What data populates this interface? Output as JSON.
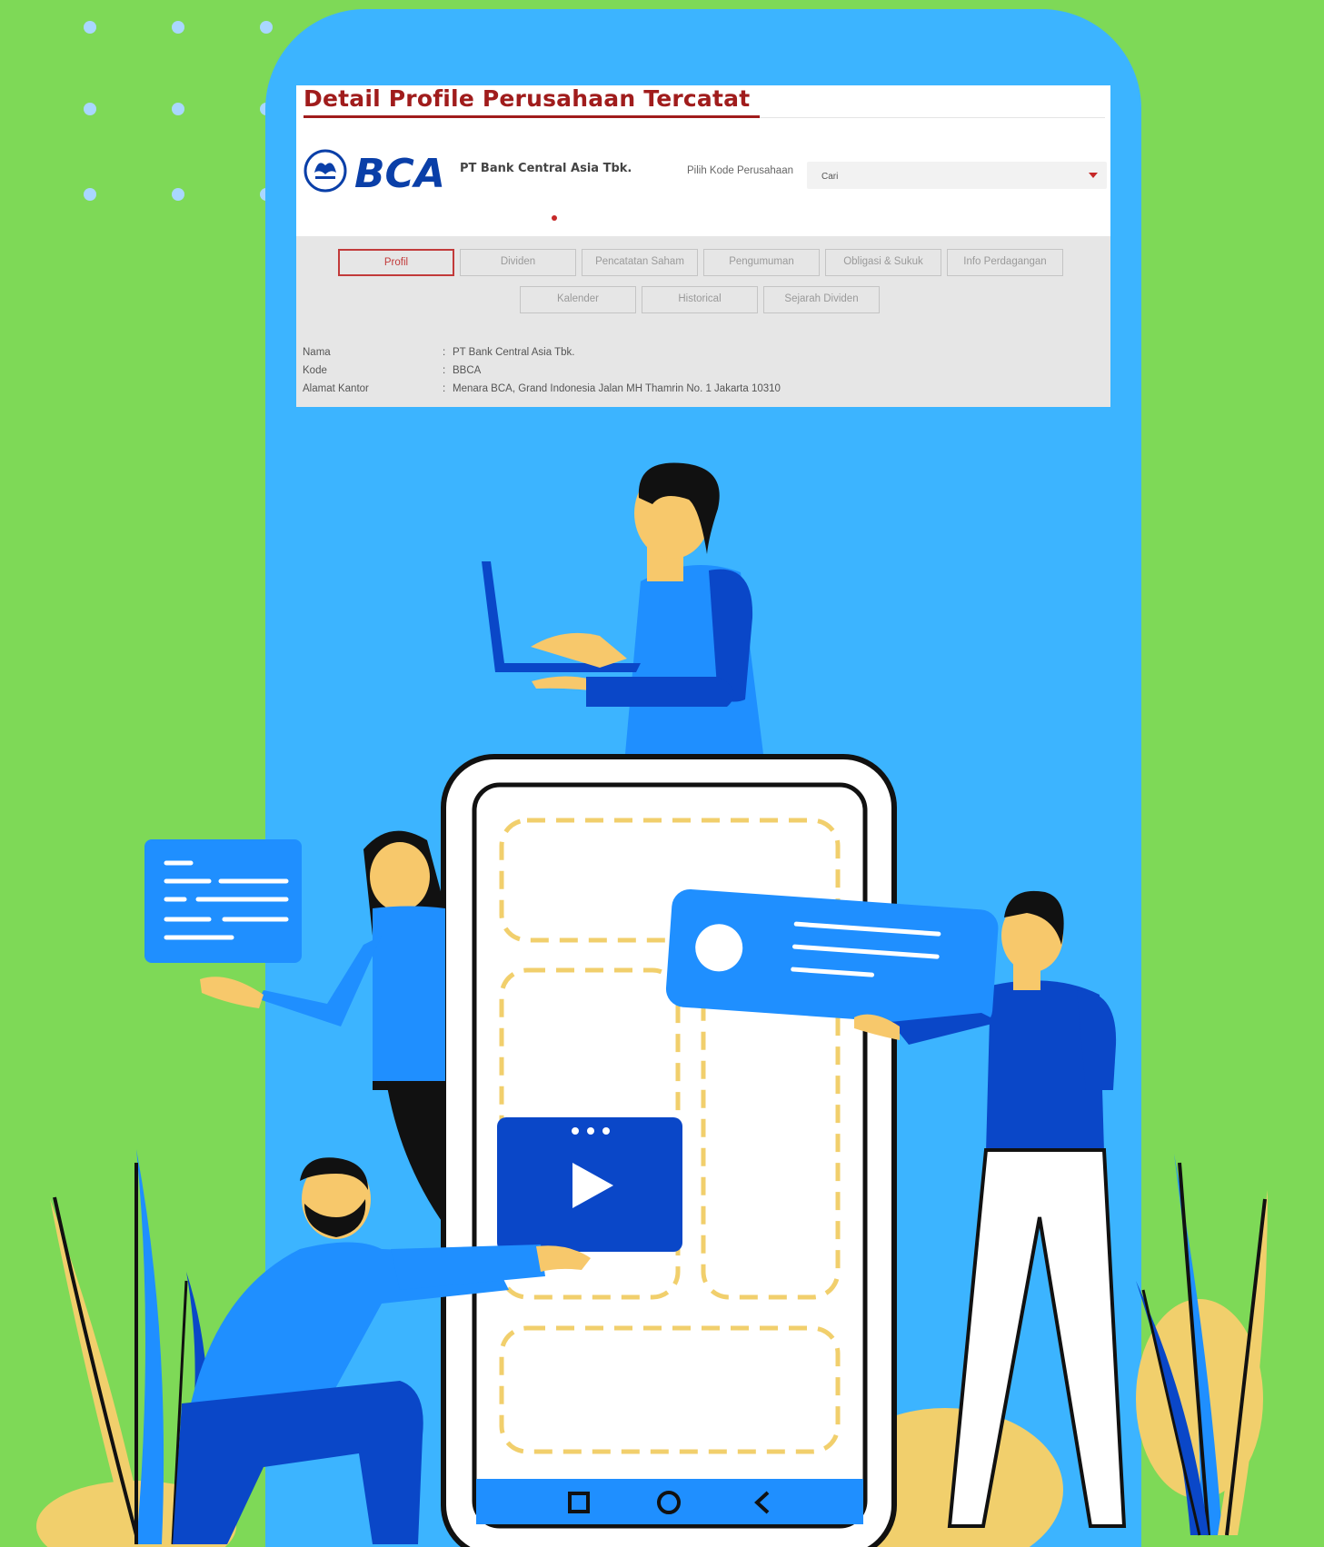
{
  "panel": {
    "title": "Detail Profile Perusahaan Tercatat",
    "company_name": "PT Bank Central Asia Tbk.",
    "logo_text": "BCA",
    "pick_label": "Pilih Kode Perusahaan",
    "select_value": "Cari"
  },
  "tabs": [
    {
      "label": "Profil"
    },
    {
      "label": "Dividen"
    },
    {
      "label": "Pencatatan Saham"
    },
    {
      "label": "Pengumuman"
    },
    {
      "label": "Obligasi & Sukuk"
    },
    {
      "label": "Info Perdagangan"
    },
    {
      "label": "Kalender"
    },
    {
      "label": "Historical"
    },
    {
      "label": "Sejarah Dividen"
    }
  ],
  "info": [
    {
      "label": "Nama",
      "value": "PT Bank Central Asia Tbk."
    },
    {
      "label": "Kode",
      "value": "BBCA"
    },
    {
      "label": "Alamat Kantor",
      "value": "Menara BCA, Grand Indonesia Jalan MH Thamrin No. 1 Jakarta 10310"
    }
  ],
  "colors": {
    "background": "#7ed957",
    "phone": "#3cb4ff",
    "accent_red": "#a01c1c",
    "bca_blue": "#0a3fa8"
  },
  "icons": [
    "play-icon",
    "square-nav-icon",
    "circle-nav-icon",
    "back-chevron-icon"
  ]
}
